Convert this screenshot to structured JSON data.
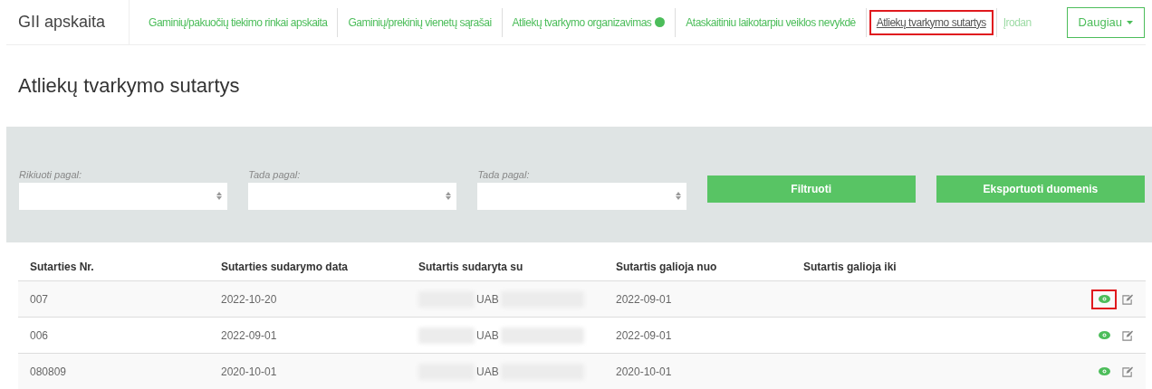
{
  "brand": "GII apskaita",
  "nav": [
    {
      "label": "Gaminių/pakuočių tiekimo rinkai apskaita",
      "selected": false,
      "help": false
    },
    {
      "label": "Gaminių/prekinių vienetų sąrašai",
      "selected": false,
      "help": false
    },
    {
      "label": "Atliekų tvarkymo organizavimas",
      "selected": false,
      "help": true
    },
    {
      "label": "Ataskaitiniu laikotarpiu veiklos nevykdė",
      "selected": false,
      "help": false
    },
    {
      "label": "Atliekų tvarkymo sutartys",
      "selected": true,
      "help": false
    },
    {
      "label": "Įrodan",
      "selected": false,
      "help": false
    }
  ],
  "more_button": "Daugiau",
  "page_title": "Atliekų tvarkymo sutartys",
  "filters": [
    {
      "label": "Rikiuoti pagal:"
    },
    {
      "label": "Tada pagal:"
    },
    {
      "label": "Tada pagal:"
    }
  ],
  "buttons": [
    "Filtruoti",
    "Eksportuoti duomenis"
  ],
  "table": {
    "columns": [
      "Sutarties Nr.",
      "Sutarties sudarymo data",
      "Sutartis sudaryta su",
      "Sutartis galioja nuo",
      "Sutartis galioja iki"
    ],
    "rows": [
      {
        "number": "007",
        "date": "2022-10-20",
        "party": "UAB",
        "valid_from": "2022-09-01",
        "view_highlighted": true
      },
      {
        "number": "006",
        "date": "2022-09-01",
        "party": "UAB",
        "valid_from": "2022-09-01",
        "view_highlighted": false
      },
      {
        "number": "080809",
        "date": "2020-10-01",
        "party": "UAB",
        "valid_from": "2020-10-01",
        "view_highlighted": false
      }
    ]
  }
}
